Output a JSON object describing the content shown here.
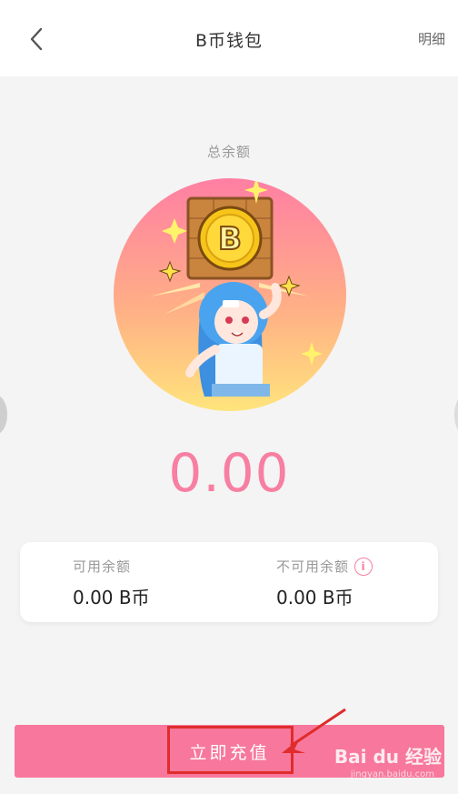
{
  "header": {
    "title": "B币钱包",
    "detail_label": "明细"
  },
  "balance": {
    "total_label": "总余额",
    "total_amount": "0.00"
  },
  "card": {
    "available_label": "可用余额",
    "available_value": "0.00 B币",
    "unavailable_label": "不可用余额",
    "unavailable_value": "0.00 B币"
  },
  "action": {
    "recharge_label": "立即充值"
  },
  "watermark": {
    "brand": "Bai du 经验",
    "sub": "jingyan.baidu.com"
  },
  "icons": [
    "back-arrow-icon",
    "info-icon",
    "coin-b-icon",
    "sparkle-icon"
  ],
  "colors": {
    "accent": "#f77fa2",
    "button": "#f7789c",
    "highlight_box": "#e02c2c"
  }
}
